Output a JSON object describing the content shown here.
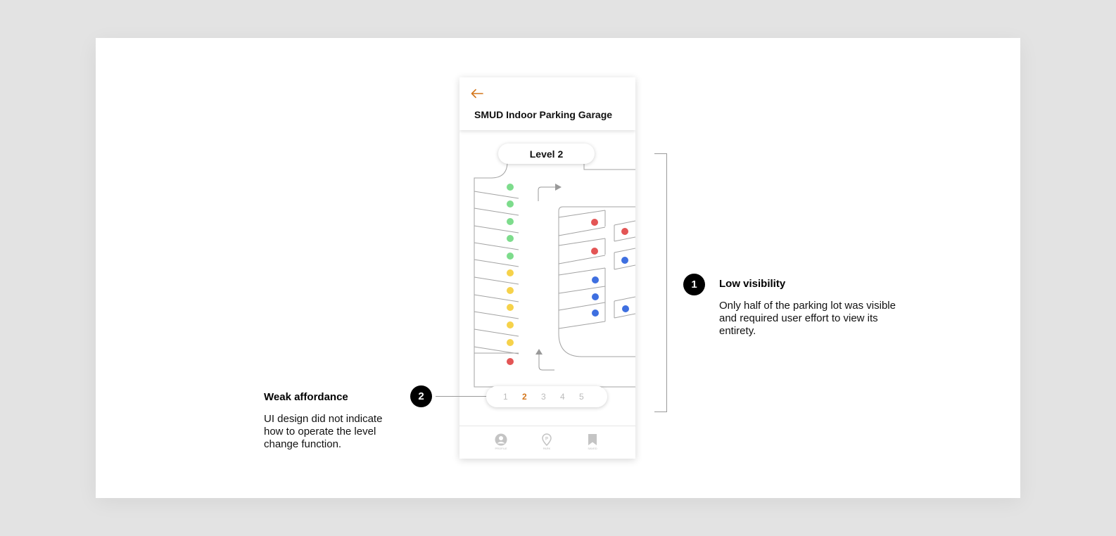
{
  "app": {
    "title": "SMUD Indoor Parking Garage",
    "level_label": "Level 2",
    "levels": [
      "1",
      "2",
      "3",
      "4",
      "5"
    ],
    "active_level": "2",
    "accent_color": "#d4761c",
    "tabs": [
      {
        "icon": "profile-icon",
        "label": "PROFILE"
      },
      {
        "icon": "map-pin-icon",
        "label": "PARK"
      },
      {
        "icon": "bookmark-icon",
        "label": "SAVED"
      }
    ]
  },
  "spot_status_colors": {
    "available": "#7ddc8c",
    "reserved": "#f6d24a",
    "occupied": "#e35555",
    "accessible": "#3e6fe0"
  },
  "annotations": [
    {
      "number": "1",
      "title": "Low visibility",
      "body": "Only half of the parking lot was visible and required user effort to view its entirety."
    },
    {
      "number": "2",
      "title": "Weak affordance",
      "body": "UI design did not indicate how to operate the level change function."
    }
  ]
}
